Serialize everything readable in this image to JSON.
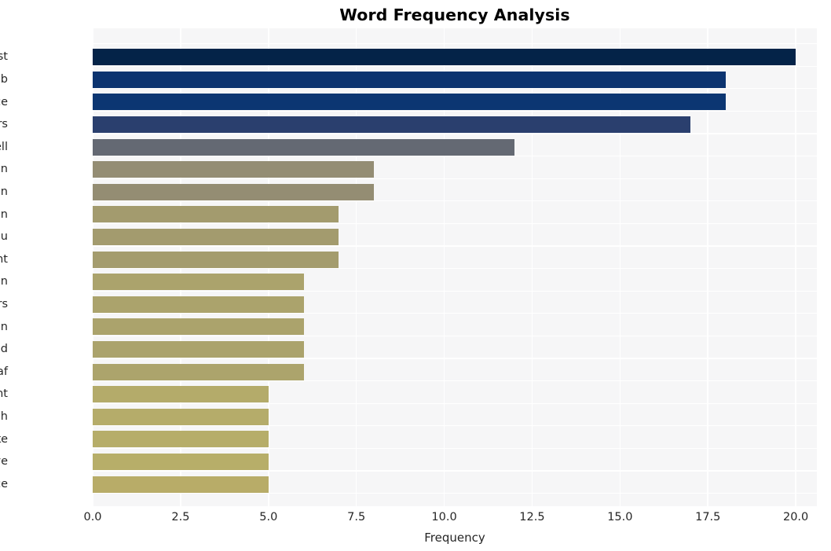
{
  "chart_data": {
    "type": "bar",
    "orientation": "horizontal",
    "title": "Word Frequency Analysis",
    "xlabel": "Frequency",
    "ylabel": "",
    "xlim": [
      0,
      20.6
    ],
    "xticks": [
      "0.0",
      "2.5",
      "5.0",
      "7.5",
      "10.0",
      "12.5",
      "15.0",
      "17.5",
      "20.0"
    ],
    "xtick_values": [
      0,
      2.5,
      5,
      7.5,
      10,
      12.5,
      15,
      17.5,
      20
    ],
    "grid": true,
    "legend": "none",
    "categories": [
      "post",
      "sub",
      "office",
      "postmasters",
      "tell",
      "prison",
      "kamran",
      "horizon",
      "fujitsu",
      "account",
      "hamilton",
      "years",
      "compensation",
      "husband",
      "ashraf",
      "government",
      "branch",
      "take",
      "live",
      "justice"
    ],
    "values": [
      20,
      18,
      18,
      17,
      12,
      8,
      8,
      7,
      7,
      7,
      6,
      6,
      6,
      6,
      6,
      5,
      5,
      5,
      5,
      5
    ],
    "bar_colors": [
      "#042348",
      "#0c3470",
      "#0c3672",
      "#2a3f6e",
      "#646973",
      "#948d74",
      "#948d73",
      "#a39b6e",
      "#a39b6e",
      "#a49c6e",
      "#ab a36c",
      "#aba36c",
      "#aba36c",
      "#aba36c",
      "#aca46c",
      "#b4ab6a",
      "#b5ac6a",
      "#b6ad69",
      "#b7ae69",
      "#b8ac68"
    ]
  },
  "style": {
    "figure_background": "#ffffff",
    "plot_background": "#f6f6f7",
    "gridline_color": "#ffffff",
    "text_color": "#262626",
    "title_color": "#000000"
  }
}
